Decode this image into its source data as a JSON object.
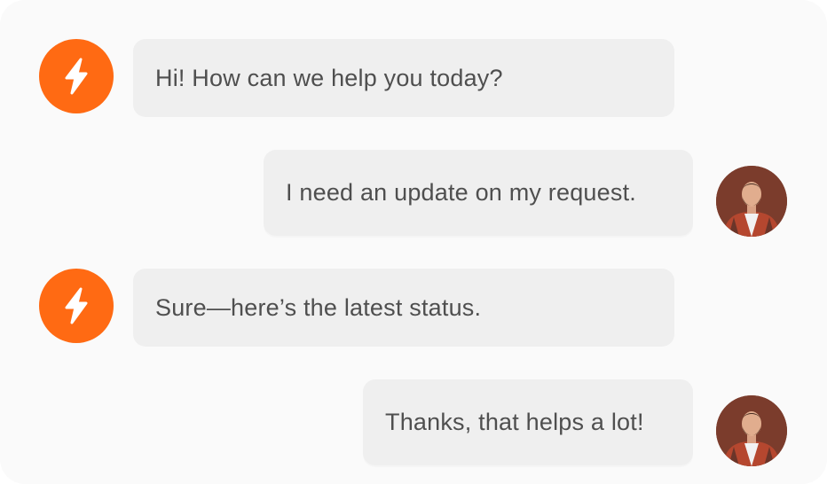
{
  "chat": {
    "brand_color": "#ff6a13",
    "bubble_color": "#efefef",
    "messages": [
      {
        "sender": "bot",
        "avatar_icon": "lightning-bolt-icon",
        "text": "Hi! How can we help you today?"
      },
      {
        "sender": "user",
        "avatar_icon": "user-photo",
        "text": "I need an update on my request."
      },
      {
        "sender": "bot",
        "avatar_icon": "lightning-bolt-icon",
        "text": "Sure—here’s the latest status."
      },
      {
        "sender": "user",
        "avatar_icon": "user-photo",
        "text": "Thanks, that helps a lot!"
      }
    ]
  }
}
